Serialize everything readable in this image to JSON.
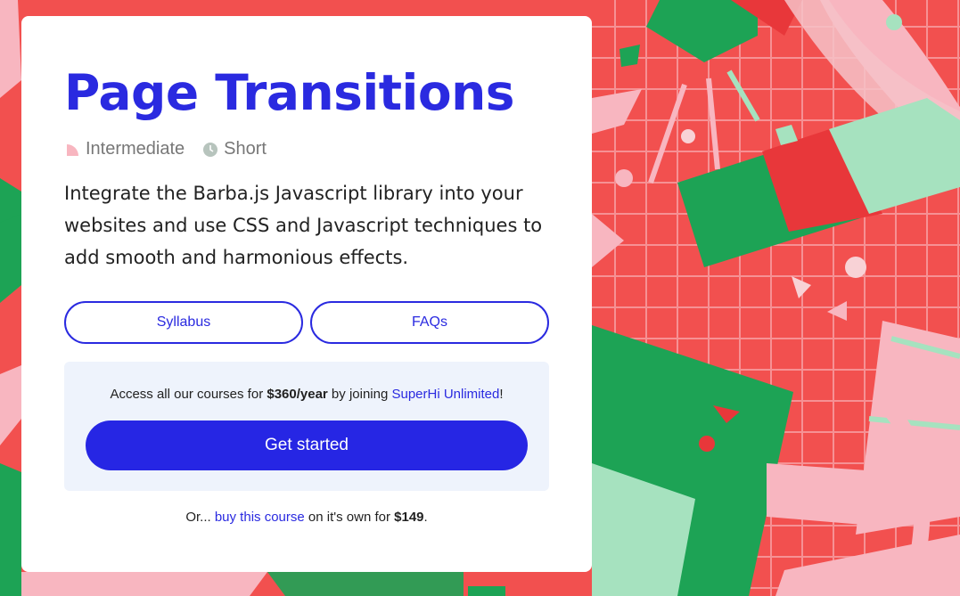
{
  "course": {
    "title": "Page Transitions",
    "level": "Intermediate",
    "length": "Short",
    "description": "Integrate the Barba.js Javascript library into your websites and use CSS and Javascript techniques to add smooth and harmonious effects."
  },
  "buttons": {
    "syllabus": "Syllabus",
    "faqs": "FAQs"
  },
  "offer": {
    "text_before": "Access all our courses for ",
    "price": "$360/year",
    "text_mid": " by joining ",
    "link": "SuperHi Unlimited",
    "text_after": "!",
    "cta": "Get started"
  },
  "footnote": {
    "prefix": "Or... ",
    "link": "buy this course",
    "mid": " on it's own for ",
    "price": "$149",
    "suffix": "."
  },
  "icons": {
    "level": "quarter-circle-icon",
    "length": "clock-icon"
  },
  "colors": {
    "accent": "#2a2ae0",
    "cta": "#2626e4",
    "background_red": "#f2504f",
    "background_green": "#1da355",
    "background_pink": "#f8b6c0",
    "offer_bg": "#eef3fc"
  }
}
